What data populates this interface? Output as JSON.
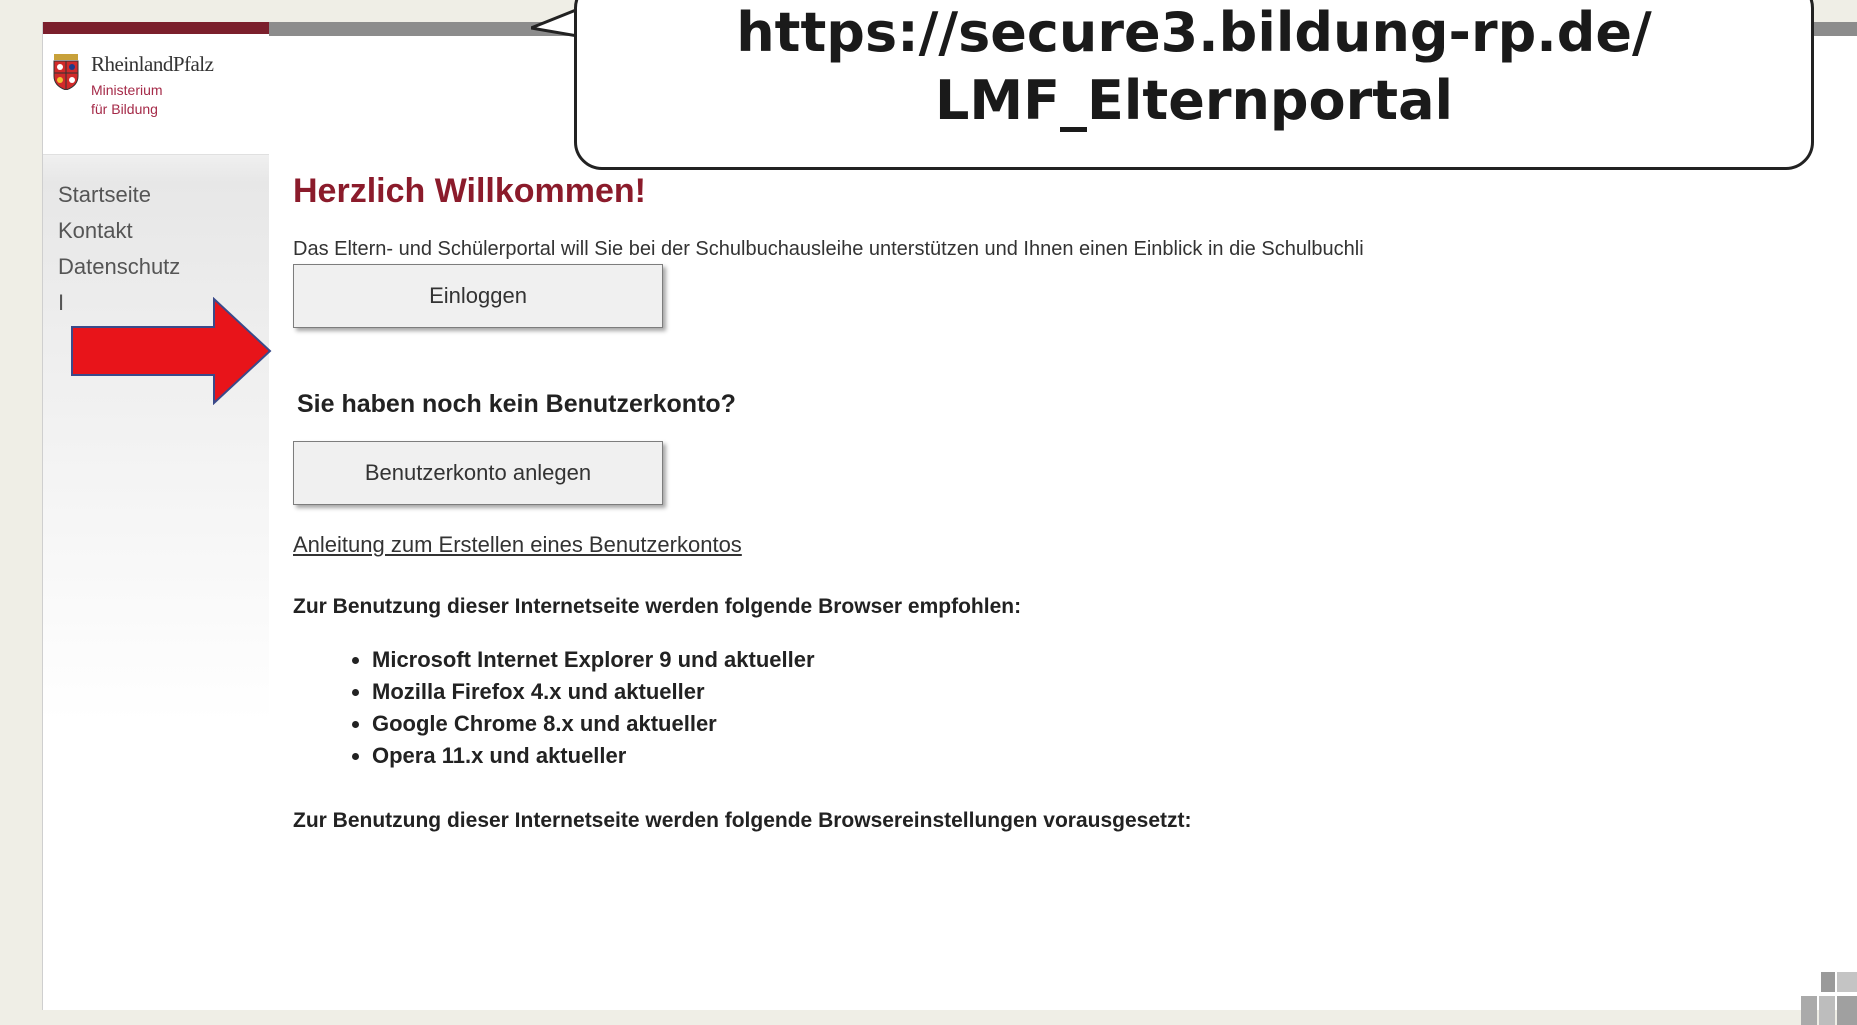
{
  "logo": {
    "name": "RheinlandPfalz",
    "line1": "Ministerium",
    "line2": "für Bildung"
  },
  "nav": {
    "items": [
      {
        "label": "Startseite"
      },
      {
        "label": "Kontakt"
      },
      {
        "label": "Datenschutz"
      },
      {
        "label": "I"
      }
    ]
  },
  "main": {
    "title": "Herzlich Willkommen!",
    "intro": "Das Eltern- und Schülerportal will Sie bei der Schulbuchausleihe unterstützen und Ihnen einen Einblick in die Schulbuchli",
    "login_label": "Einloggen",
    "no_account_heading": "Sie haben noch kein Benutzerkonto?",
    "register_label": "Benutzerkonto anlegen",
    "guide_link": "Anleitung zum Erstellen eines Benutzerkontos",
    "browser_rec": "Zur Benutzung dieser Internetseite werden folgende Browser empfohlen:",
    "browsers": [
      "Microsoft Internet Explorer 9 und aktueller",
      "Mozilla Firefox 4.x und aktueller",
      "Google Chrome 8.x und aktueller",
      "Opera 11.x und aktueller"
    ],
    "settings_rec": "Zur Benutzung dieser Internetseite werden folgende Browsereinstellungen vorausgesetzt:"
  },
  "callout": {
    "line1": "https://secure3.bildung-rp.de/",
    "line2": "LMF_Elternportal"
  },
  "colors": {
    "title": "#8b1b2b",
    "brand": "#7b1f2c",
    "arrow": "#e8141a"
  }
}
